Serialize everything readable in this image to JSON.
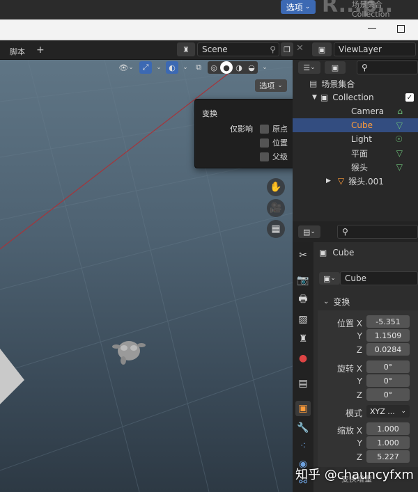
{
  "top": {
    "button_label": "选项",
    "bg_text": "R...p..",
    "ghost_lines": [
      "场景集合",
      "Collection"
    ]
  },
  "header": {
    "tab_label": "脚本",
    "add_tab": "+",
    "scene_name": "Scene",
    "viewlayer_name": "ViewLayer"
  },
  "viewport": {
    "options_label": "选项",
    "popup": {
      "title": "变换",
      "affect_label": "仅影响",
      "options": [
        "原点",
        "位置",
        "父级"
      ]
    }
  },
  "outliner": {
    "root": "场景集合",
    "items": [
      {
        "label": "Collection",
        "icon": "collection-icon",
        "color": "#cccccc",
        "selected": false
      },
      {
        "label": "Camera",
        "icon": "camera-icon",
        "color": "#cccccc",
        "selected": false
      },
      {
        "label": "Cube",
        "icon": "mesh-icon",
        "color": "#ff9c3a",
        "selected": true
      },
      {
        "label": "Light",
        "icon": "light-icon",
        "color": "#cccccc",
        "selected": false
      },
      {
        "label": "平面",
        "icon": "mesh-icon",
        "color": "#cccccc",
        "selected": false
      },
      {
        "label": "猴头",
        "icon": "mesh-icon",
        "color": "#cccccc",
        "selected": false
      },
      {
        "label": "猴头.001",
        "icon": "mesh-icon",
        "color": "#cccccc",
        "selected": false
      }
    ]
  },
  "properties": {
    "object_name": "Cube",
    "datablock_name": "Cube",
    "section": "变换",
    "location_label": "位置 X",
    "location": {
      "x": "-5.351",
      "y": "1.1509",
      "z": "0.0284"
    },
    "rotation_label": "旋转 X",
    "rotation": {
      "x": "0°",
      "y": "0°",
      "z": "0°"
    },
    "mode_label": "模式",
    "mode_value": "XYZ ...",
    "scale_label": "缩放 X",
    "scale": {
      "x": "1.000",
      "y": "1.000",
      "z": "5.227"
    },
    "axis_y": "Y",
    "axis_z": "Z",
    "delta_label": "变换增量"
  },
  "watermark": "知乎 @chauncyfxm",
  "colors": {
    "accent": "#3c69b3",
    "selected_row": "#334d80",
    "active_object": "#ff9c3a"
  }
}
